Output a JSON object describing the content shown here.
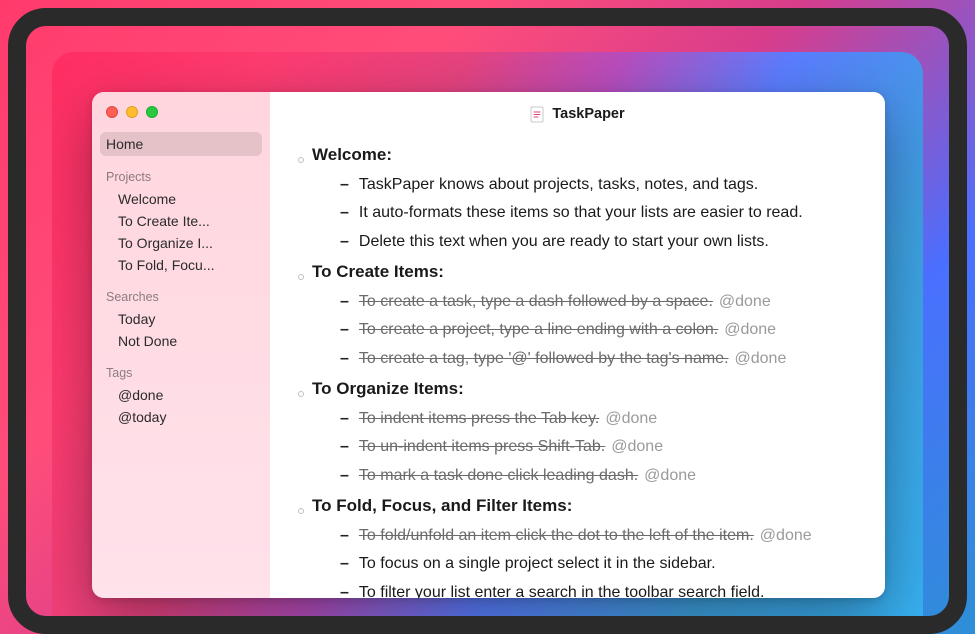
{
  "window": {
    "title": "TaskPaper"
  },
  "sidebar": {
    "home_label": "Home",
    "sections": {
      "projects": {
        "label": "Projects",
        "items": [
          "Welcome",
          "To Create Ite...",
          "To Organize I...",
          "To Fold, Focu..."
        ]
      },
      "searches": {
        "label": "Searches",
        "items": [
          "Today",
          "Not Done"
        ]
      },
      "tags": {
        "label": "Tags",
        "items": [
          "@done",
          "@today"
        ]
      }
    }
  },
  "document": {
    "projects": [
      {
        "title": "Welcome:",
        "tasks": [
          {
            "text": "TaskPaper knows about projects, tasks, notes, and tags.",
            "done": false
          },
          {
            "text": "It auto-formats these items so that your lists are easier to read.",
            "done": false
          },
          {
            "text": "Delete this text when you are ready to start your own lists.",
            "done": false
          }
        ]
      },
      {
        "title": "To Create Items:",
        "tasks": [
          {
            "text": "To create a task, type a dash followed by a space.",
            "done": true,
            "tag": "@done"
          },
          {
            "text": "To create a project, type a line ending with a colon.",
            "done": true,
            "tag": "@done"
          },
          {
            "text": "To create a tag, type '@' followed by the tag's name.",
            "done": true,
            "tag": "@done"
          }
        ]
      },
      {
        "title": "To Organize Items:",
        "tasks": [
          {
            "text": "To indent items press the Tab key.",
            "done": true,
            "tag": "@done"
          },
          {
            "text": "To un-indent items press Shift-Tab.",
            "done": true,
            "tag": "@done"
          },
          {
            "text": "To mark a task done click leading dash.",
            "done": true,
            "tag": "@done"
          }
        ]
      },
      {
        "title": "To Fold, Focus, and Filter Items:",
        "tasks": [
          {
            "text": "To fold/unfold an item click the dot to the left of the item.",
            "done": true,
            "tag": "@done"
          },
          {
            "text": "To focus on a single project select it in the sidebar.",
            "done": false
          },
          {
            "text": "To filter your list enter a search in the toolbar search field.",
            "done": false
          }
        ]
      }
    ]
  }
}
